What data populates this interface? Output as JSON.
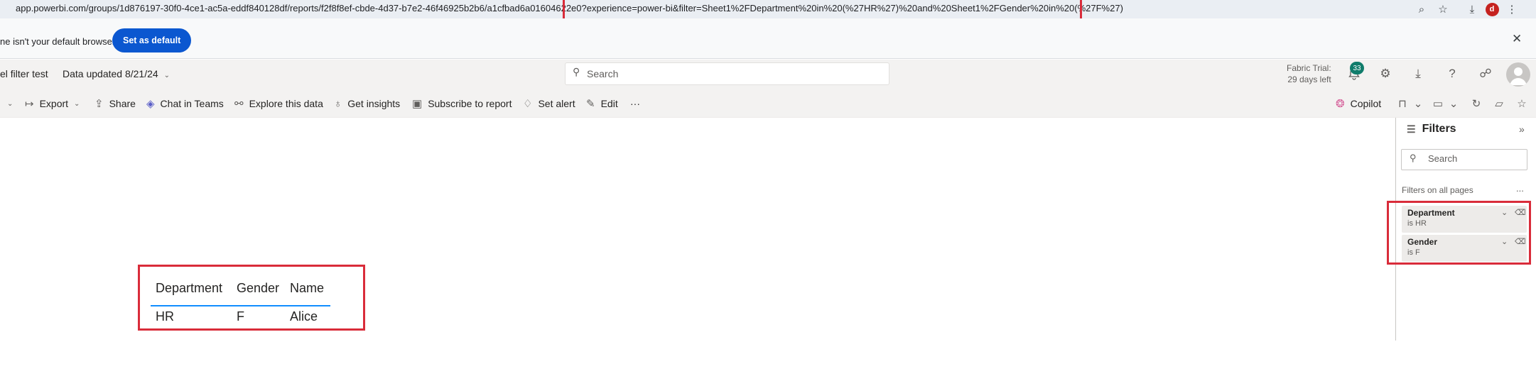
{
  "browser": {
    "url": "app.powerbi.com/groups/1d876197-30f0-4ce1-ac5a-eddf840128df/reports/f2f8f8ef-cbde-4d37-b7e2-46f46925b2b6/a1cfbad6a01604622e0?experience=power-bi&filter=Sheet1%2FDepartment%20in%20(%27HR%27)%20and%20Sheet1%2FGender%20in%20(%27F%27)",
    "profile_initial": "d"
  },
  "banner": {
    "text": "ne isn't your default browser",
    "button": "Set as default",
    "close": "✕"
  },
  "header": {
    "report_name": "el filter test",
    "data_updated": "Data updated 8/21/24",
    "search_placeholder": "Search",
    "trial_line1": "Fabric Trial:",
    "trial_line2": "29 days left",
    "notification_count": "33"
  },
  "actions": {
    "export": "Export",
    "share": "Share",
    "chat_in_teams": "Chat in Teams",
    "explore": "Explore this data",
    "insights": "Get insights",
    "subscribe": "Subscribe to report",
    "set_alert": "Set alert",
    "edit": "Edit",
    "more": "···",
    "copilot": "Copilot"
  },
  "table": {
    "headers": [
      "Department",
      "Gender",
      "Name"
    ],
    "rows": [
      [
        "HR",
        "F",
        "Alice"
      ]
    ]
  },
  "filters": {
    "title": "Filters",
    "search_placeholder": "Search",
    "section_label": "Filters on all pages",
    "more": "...",
    "cards": [
      {
        "name": "Department",
        "value": "is HR"
      },
      {
        "name": "Gender",
        "value": "is F"
      }
    ]
  },
  "colors": {
    "highlight": "#d92c3a",
    "accent_blue": "#118dff",
    "button_blue": "#0b57d0",
    "badge_green": "#107c6b"
  }
}
